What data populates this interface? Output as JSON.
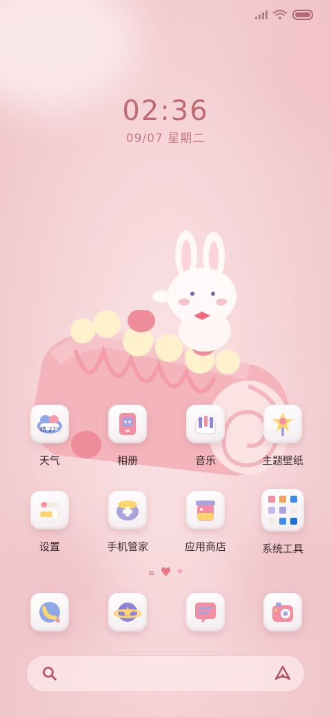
{
  "status_bar": {
    "signal_icon": "signal-bars-icon",
    "wifi_icon": "wifi-icon",
    "battery_icon": "battery-icon"
  },
  "clock": {
    "time": "02:36",
    "date": "09/07 星期二"
  },
  "apps_row1": [
    {
      "label": "天气",
      "icon": "weather-icon",
      "badge": "晴 27°"
    },
    {
      "label": "相册",
      "icon": "gallery-icon"
    },
    {
      "label": "音乐",
      "icon": "music-icon"
    },
    {
      "label": "主题壁纸",
      "icon": "themes-icon"
    }
  ],
  "apps_row2": [
    {
      "label": "设置",
      "icon": "settings-icon"
    },
    {
      "label": "手机管家",
      "icon": "security-icon"
    },
    {
      "label": "应用商店",
      "icon": "app-store-icon"
    },
    {
      "label": "系统工具",
      "icon": "system-tools-folder-icon"
    }
  ],
  "dock": [
    {
      "icon": "phone-icon"
    },
    {
      "icon": "browser-icon"
    },
    {
      "icon": "messages-icon"
    },
    {
      "icon": "camera-icon"
    }
  ],
  "search": {
    "search_icon": "search-icon",
    "assistant_icon": "assistant-icon"
  },
  "colors": {
    "accent": "#c06a73",
    "background": "#f6d5d8",
    "label": "#3a2a2c"
  }
}
